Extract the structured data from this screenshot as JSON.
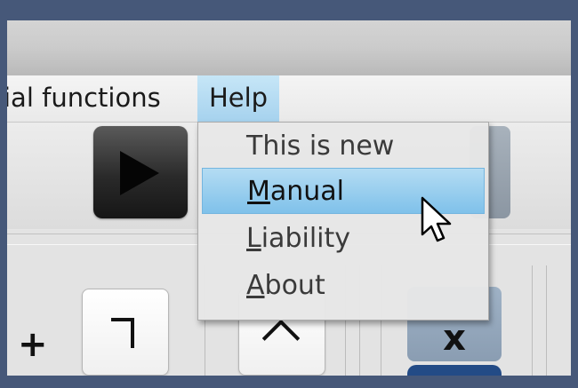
{
  "menubar": {
    "items": [
      {
        "label": "ial functions"
      },
      {
        "label": "Help"
      }
    ]
  },
  "toolbar": {
    "play_icon": "play-icon"
  },
  "panel": {
    "plus_label": "+",
    "key_x_label": "x",
    "icons": [
      "corner-icon",
      "caret-up-icon"
    ]
  },
  "help_menu": {
    "items": [
      {
        "mnemonic": "",
        "rest": "This is new"
      },
      {
        "mnemonic": "M",
        "rest": "anual",
        "highlighted": true
      },
      {
        "mnemonic": "L",
        "rest": "iability"
      },
      {
        "mnemonic": "A",
        "rest": "bout"
      }
    ]
  },
  "colors": {
    "frame": "#465879",
    "highlight": "#9bd0ef",
    "play_button": "#2a2a2a",
    "key_x": "#9fb2c6",
    "key_blue": "#234b86"
  },
  "cursor": "arrow-cursor-icon"
}
